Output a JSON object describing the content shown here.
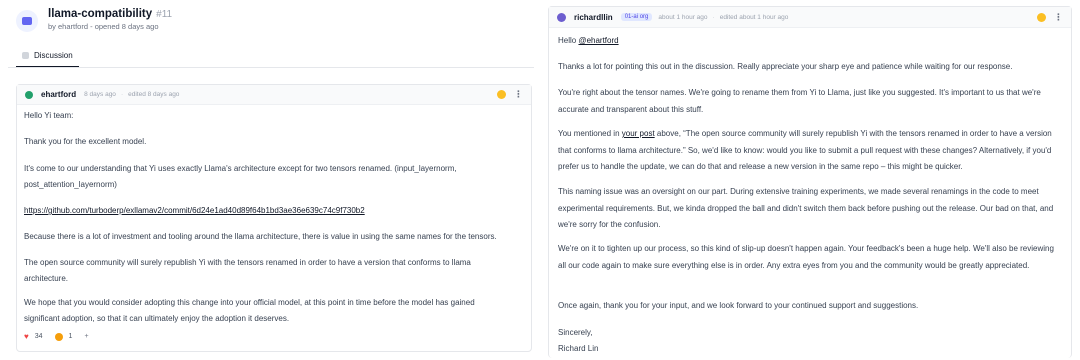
{
  "repo": {
    "title": "llama-compatibility",
    "number": "#11",
    "subtitle": "by ehartford - opened 8 days ago"
  },
  "tabs": [
    {
      "label": "Discussion"
    }
  ],
  "left_comment": {
    "author": "ehartford",
    "time": "8 days ago",
    "edited": "edited 8 days ago",
    "paragraphs": [
      "Hello Yi team:",
      "Thank you for the excellent model.",
      "It's come to our understanding that Yi uses exactly Llama's architecture except for two tensors renamed. (input_layernorm, post_attention_layernorm)",
      "https://github.com/turboderp/exllamav2/commit/6d24e1ad40d89f64b1bd3ae36e639c74c9f730b2",
      "Because there is a lot of investment and tooling around the llama architecture, there is value in using the same names for the tensors.",
      "The open source community will surely republish Yi with the tensors renamed in order to have a version that conforms to llama architecture.",
      "We hope that you would consider adopting this change into your official model, at this point in time before the model has gained significant adoption, so that it can ultimately enjoy the adoption it deserves."
    ],
    "reactions": [
      {
        "icon": "heart-icon",
        "count": "34"
      },
      {
        "icon": "sad-face-icon",
        "count": "1"
      }
    ],
    "add_reaction": "+"
  },
  "right_comment": {
    "author": "richardllin",
    "org": "01-ai org",
    "time": "about 1 hour ago",
    "edited": "edited about 1 hour ago",
    "greeting_prefix": "Hello ",
    "greeting_mention": "@ehartford",
    "p1": "Thanks a lot for pointing this out in the discussion. Really appreciate your sharp eye and patience while waiting for our response.",
    "p2": "You're right about the tensor names. We're going to rename them from Yi to Llama, just like you suggested. It's important to us that we're accurate and transparent about this stuff.",
    "p3_prefix": "You mentioned in ",
    "p3_link": "your post",
    "p3_rest": " above, “The open source community will surely republish Yi with the tensors renamed in order to have a version that conforms to llama architecture.” So, we'd like to know: would you like to submit a pull request with these changes? Alternatively, if you'd prefer us to handle the update, we can do that and release a new version in the same repo – this might be quicker.",
    "p4": "This naming issue was an oversight on our part. During extensive training experiments, we made several renamings in the code to meet experimental requirements. But, we kinda dropped the ball and didn't switch them back before pushing out the release. Our bad on that, and we're sorry for the confusion.",
    "p5": "We're on it to tighten up our process, so this kind of slip-up doesn't happen again. Your feedback's been a huge help. We'll also be reviewing all our code again to make sure everything else is in order. Any extra eyes from you and the community would be greatly appreciated.",
    "p6": "Once again, thank you for your input, and we look forward to your continued support and suggestions.",
    "closing": "Sincerely,",
    "signature": "Richard Lin"
  }
}
